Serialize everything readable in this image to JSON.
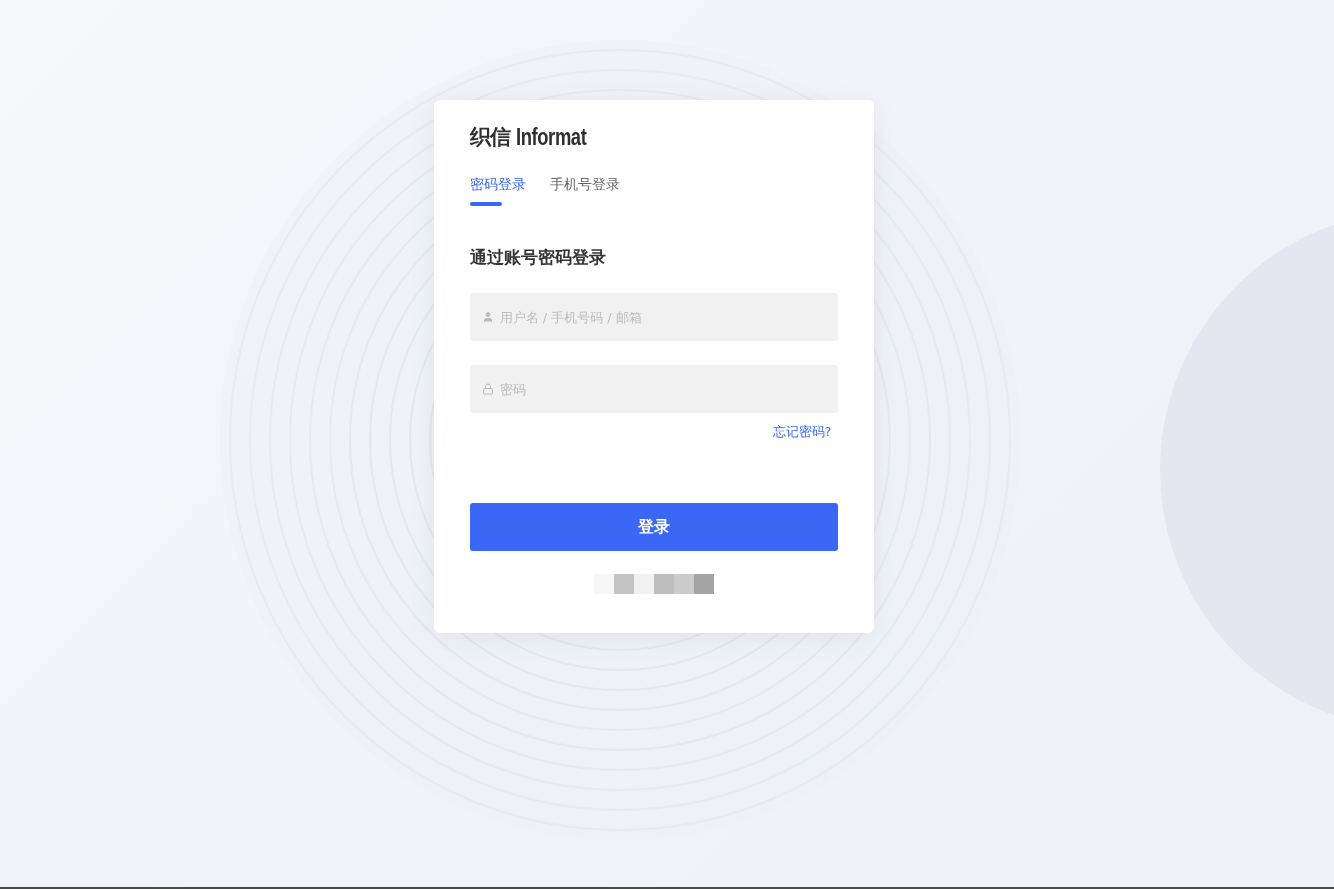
{
  "logo": {
    "mark": "织信",
    "name": "Informat"
  },
  "tabs": [
    {
      "label": "密码登录",
      "selected": true
    },
    {
      "label": "手机号登录",
      "selected": false
    }
  ],
  "heading": "通过账号密码登录",
  "fields": [
    {
      "kind": "user",
      "placeholder": "用户名 / 手机号码 / 邮箱"
    },
    {
      "kind": "password",
      "placeholder": "密码"
    }
  ],
  "forgot_link": "忘记密码?",
  "submit_button": "登录"
}
